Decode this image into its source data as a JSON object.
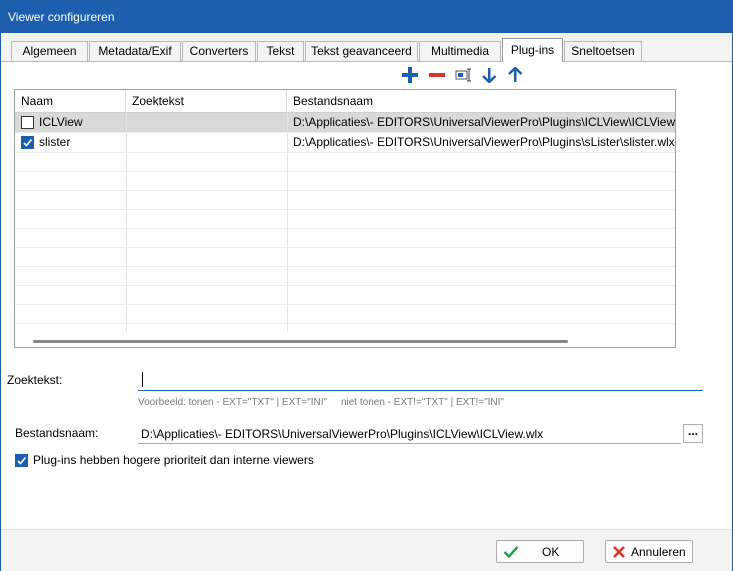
{
  "window": {
    "title": "Viewer configureren"
  },
  "tabs": [
    {
      "label": "Algemeen"
    },
    {
      "label": "Metadata/Exif"
    },
    {
      "label": "Converters"
    },
    {
      "label": "Tekst"
    },
    {
      "label": "Tekst geavanceerd"
    },
    {
      "label": "Multimedia"
    },
    {
      "label": "Plug-ins"
    },
    {
      "label": "Sneltoetsen"
    }
  ],
  "active_tab": "Plug-ins",
  "toolbar": {
    "icons": [
      "add-icon",
      "remove-icon",
      "rename-icon",
      "move-down-icon",
      "move-up-icon"
    ],
    "colors": {
      "add": "#1b5fae",
      "remove": "#d9342b",
      "arrows": "#1b5fae"
    }
  },
  "grid": {
    "columns": [
      "Naam",
      "Zoektekst",
      "Bestandsnaam"
    ],
    "rows": [
      {
        "checked": false,
        "name": "ICLView",
        "search": "",
        "file": "D:\\Applicaties\\- EDITORS\\UniversalViewerPro\\Plugins\\ICLView\\ICLView.wlx",
        "selected": true
      },
      {
        "checked": true,
        "name": "slister",
        "search": "",
        "file": "D:\\Applicaties\\- EDITORS\\UniversalViewerPro\\Plugins\\sLister\\slister.wlx",
        "selected": false
      }
    ]
  },
  "search_field": {
    "label": "Zoektekst:",
    "value": "",
    "hint": "Voorbeeld: tonen - EXT=\"TXT\" | EXT=\"INI\"     niet tonen - EXT!=\"TXT\" | EXT!=\"INI\""
  },
  "file_field": {
    "label": "Bestandsnaam:",
    "value": "D:\\Applicaties\\- EDITORS\\UniversalViewerPro\\Plugins\\ICLView\\ICLView.wlx",
    "browse_label": "..."
  },
  "priority_checkbox": {
    "checked": true,
    "label": "Plug-ins hebben hogere prioriteit dan interne viewers"
  },
  "buttons": {
    "ok": "OK",
    "cancel": "Annuleren"
  },
  "accent_color": "#1b5fae"
}
